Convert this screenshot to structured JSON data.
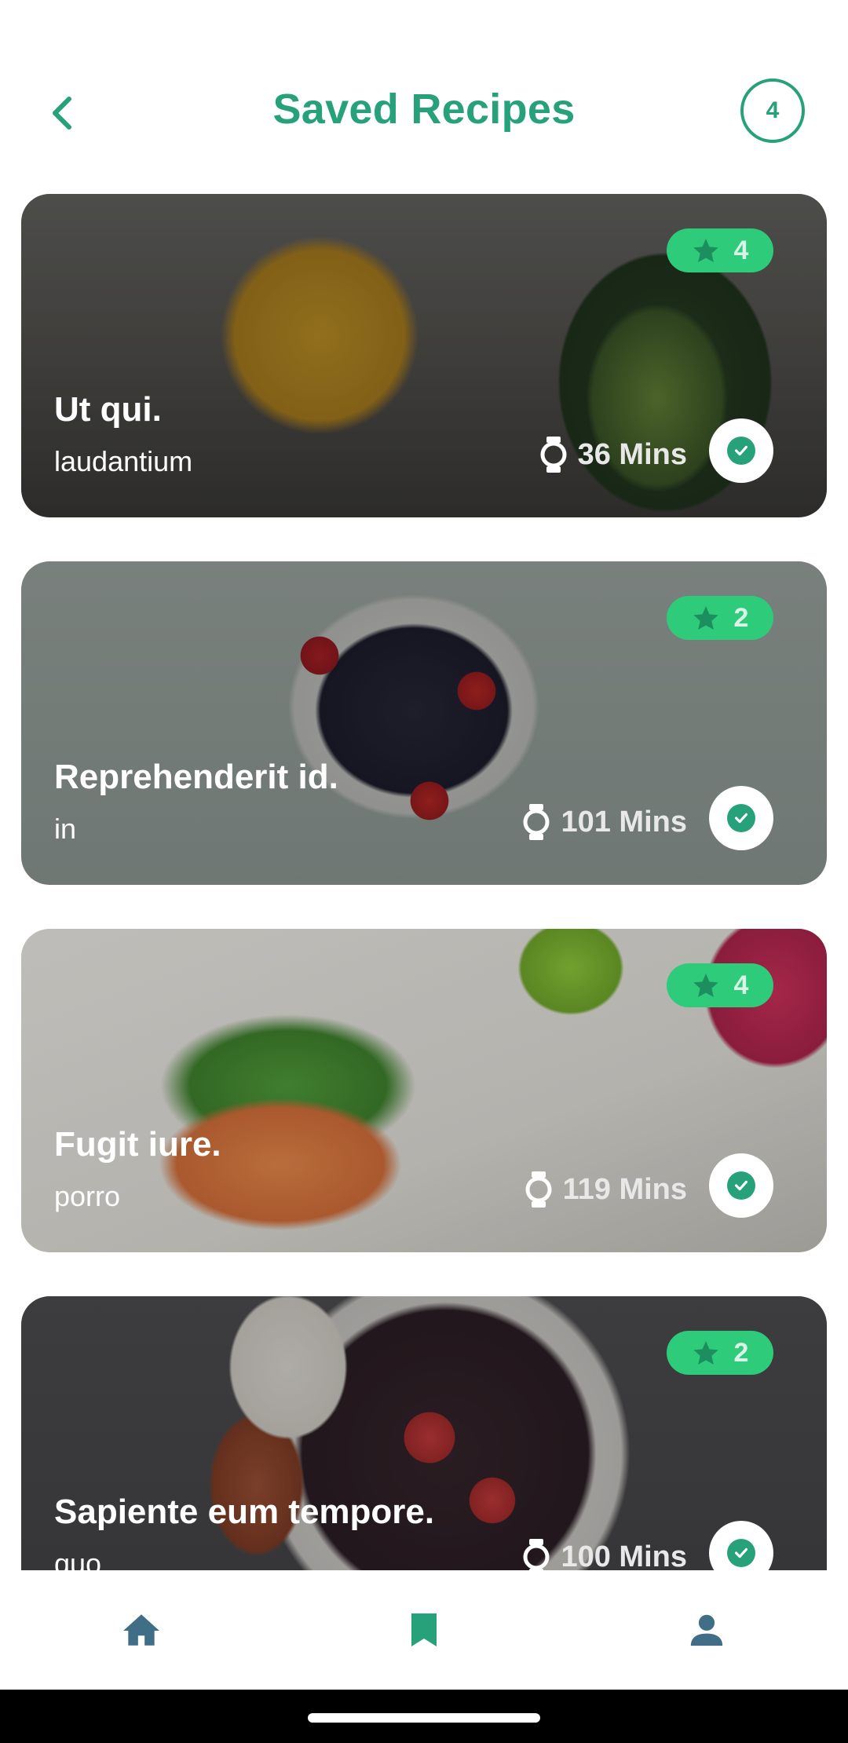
{
  "header": {
    "title": "Saved Recipes",
    "count": "4"
  },
  "colors": {
    "accent": "#26a17a",
    "rating_badge": "#2ecc7a",
    "nav_inactive": "#3f6e86"
  },
  "recipes": [
    {
      "title": "Ut qui.",
      "subtitle": "laudantium",
      "rating": "4",
      "time": "36 Mins"
    },
    {
      "title": "Reprehenderit id.",
      "subtitle": "in",
      "rating": "2",
      "time": "101 Mins"
    },
    {
      "title": "Fugit iure.",
      "subtitle": "porro",
      "rating": "4",
      "time": "119 Mins"
    },
    {
      "title": "Sapiente eum tempore.",
      "subtitle": "quo",
      "rating": "2",
      "time": "100 Mins"
    }
  ],
  "bottom_nav": {
    "items": [
      {
        "icon": "home-icon",
        "active": false
      },
      {
        "icon": "bookmark-icon",
        "active": true
      },
      {
        "icon": "person-icon",
        "active": false
      }
    ]
  }
}
